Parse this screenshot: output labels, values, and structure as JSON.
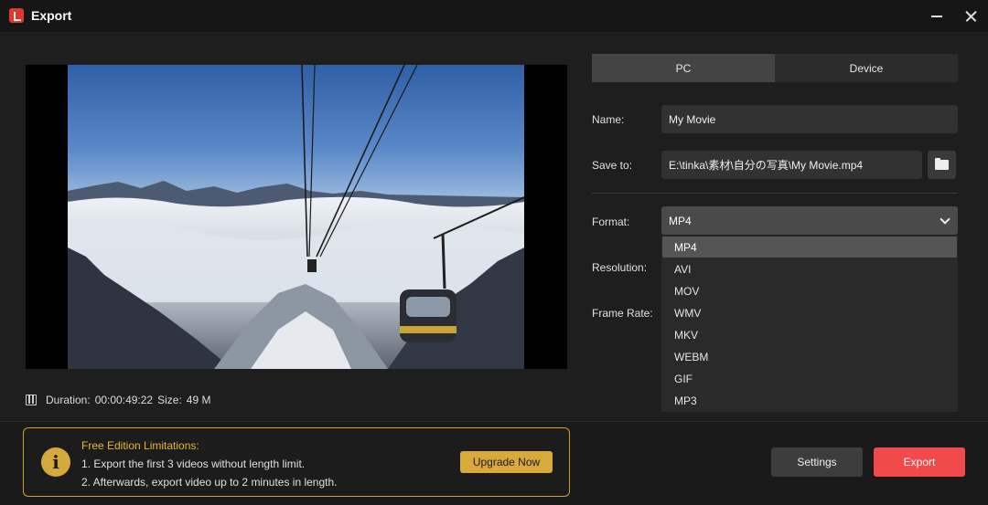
{
  "window": {
    "title": "Export",
    "app_icon": "app-logo-icon",
    "minimize_icon": "minimize-icon",
    "close_icon": "close-icon"
  },
  "preview": {
    "image": "cable-car over snowy mountains and sea of clouds",
    "duration_label": "Duration:",
    "duration_value": "00:00:49:22",
    "size_label": "Size:",
    "size_value": "49 M",
    "film_icon": "film-icon"
  },
  "tabs": [
    {
      "label": "PC",
      "active": true
    },
    {
      "label": "Device",
      "active": false
    }
  ],
  "form": {
    "name_label": "Name:",
    "name_value": "My Movie",
    "save_label": "Save to:",
    "save_value": "E:\\tinka\\素材\\自分の写真\\My Movie.mp4",
    "folder_icon": "folder-icon",
    "format_label": "Format:",
    "format_value": "MP4",
    "resolution_label": "Resolution:",
    "frame_rate_label": "Frame Rate:"
  },
  "format_options": [
    "MP4",
    "AVI",
    "MOV",
    "WMV",
    "MKV",
    "WEBM",
    "GIF",
    "MP3"
  ],
  "notice": {
    "title": "Free Edition Limitations:",
    "line1": "1. Export the first 3 videos without length limit.",
    "line2": "2. Afterwards, export video up to 2 minutes in length.",
    "upgrade_label": "Upgrade Now",
    "icon": "info-icon"
  },
  "actions": {
    "settings_label": "Settings",
    "export_label": "Export"
  },
  "colors": {
    "accent": "#f04a4a",
    "warning": "#d9a93c",
    "background": "#1e1e1e"
  }
}
